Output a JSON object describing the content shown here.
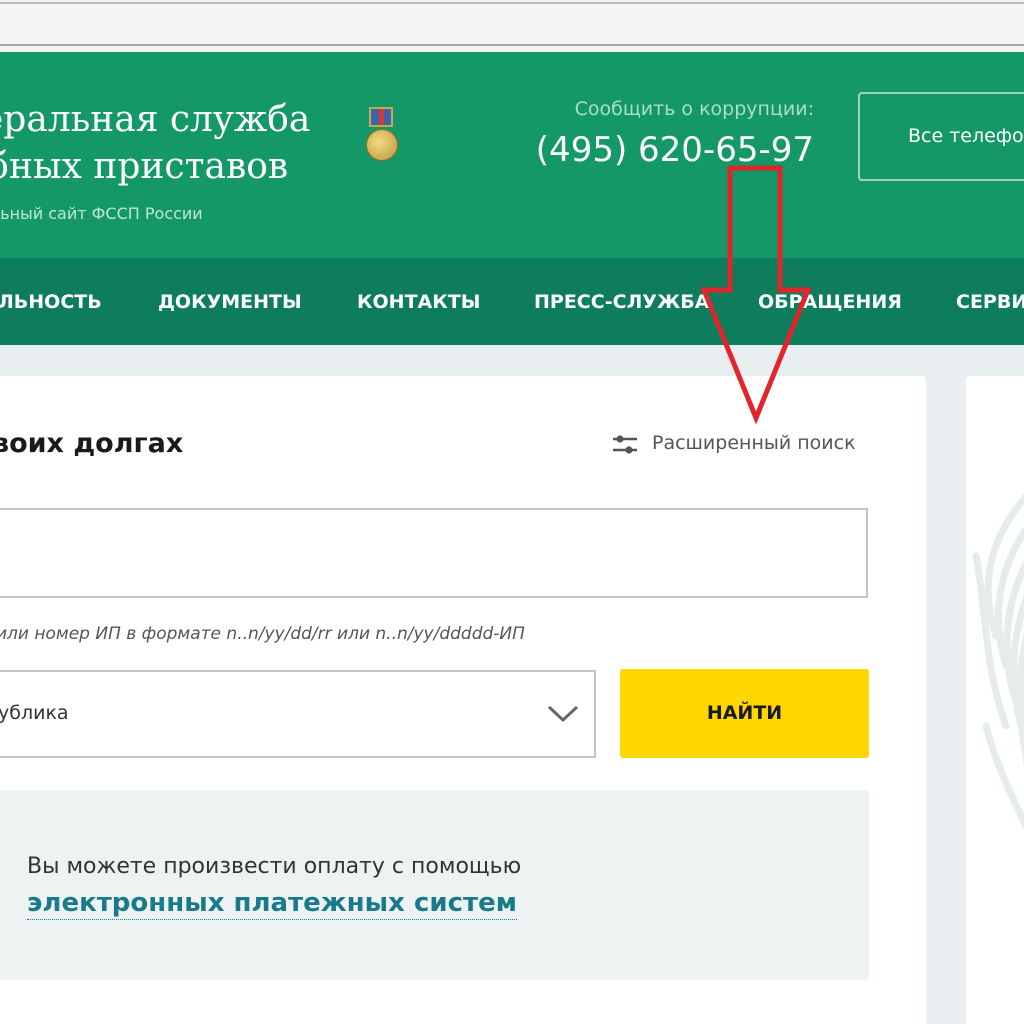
{
  "header": {
    "title_line1": "еральная служба",
    "title_line2": "ебных приставов",
    "subtitle": "льный сайт ФССП России",
    "corruption_label": "Сообщить о коррупции:",
    "corruption_phone": "(495) 620-65-97",
    "phones_button": "Все телефоны"
  },
  "nav": {
    "items": [
      {
        "label": "ЛЬНОСТЬ"
      },
      {
        "label": "ДОКУМЕНТЫ"
      },
      {
        "label": "КОНТАКТЫ"
      },
      {
        "label": "ПРЕСС-СЛУЖБА"
      },
      {
        "label": "ОБРАЩЕНИЯ"
      },
      {
        "label": "СЕРВИСЫ"
      }
    ]
  },
  "search": {
    "title": "воих долгах",
    "advanced_search": "Расширенный поиск",
    "query_value": "",
    "hint": "или номер ИП в формате n..n/yy/dd/rr или n..n/yy/ddddd-ИП",
    "region_value": "ублика",
    "find_button": "НАЙТИ"
  },
  "payment": {
    "text": "Вы можете произвести оплату с помощью",
    "link": "электронных платежных систем"
  },
  "colors": {
    "header_green": "#159868",
    "nav_green": "#0d7d5b",
    "find_yellow": "#ffd600",
    "annotation_red": "#e0262b",
    "link_teal": "#187a8a"
  }
}
